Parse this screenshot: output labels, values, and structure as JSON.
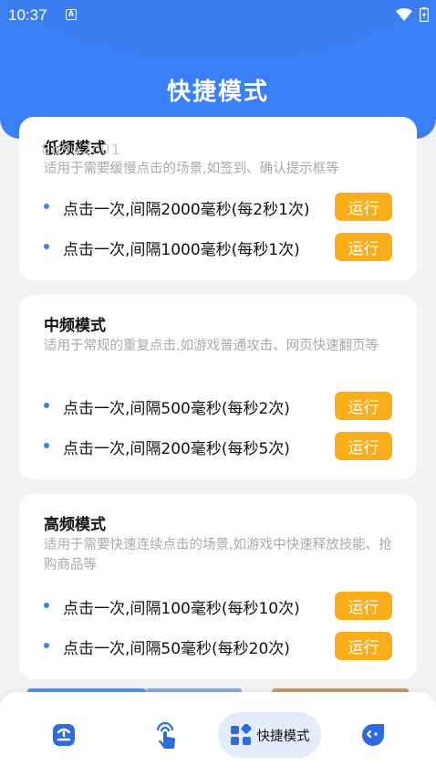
{
  "status_bar": {
    "time": "10:37",
    "badge": "A"
  },
  "header": {
    "title": "快捷模式"
  },
  "ghost_text": "8b9a2c01",
  "cards": [
    {
      "title": "低频模式",
      "desc": "适用于需要缓慢点击的场景,如签到、确认提示框等",
      "rows": [
        {
          "text": "点击一次,间隔2000毫秒(每2秒1次)",
          "button": "运行"
        },
        {
          "text": "点击一次,间隔1000毫秒(每秒1次)",
          "button": "运行"
        }
      ]
    },
    {
      "title": "中频模式",
      "desc": "适用于常规的重复点击,如游戏普通攻击、网页快速翻页等",
      "rows": [
        {
          "text": "点击一次,间隔500毫秒(每秒2次)",
          "button": "运行"
        },
        {
          "text": "点击一次,间隔200毫秒(每秒5次)",
          "button": "运行"
        }
      ]
    },
    {
      "title": "高频模式",
      "desc": "适用于需要快速连续点击的场景,如游戏中快速释放技能、抢购商品等",
      "rows": [
        {
          "text": "点击一次,间隔100毫秒(每秒10次)",
          "button": "运行"
        },
        {
          "text": "点击一次,间隔50毫秒(每秒20次)",
          "button": "运行"
        }
      ]
    }
  ],
  "nav": {
    "items": [
      {
        "icon": "home-icon"
      },
      {
        "icon": "tap-icon"
      },
      {
        "icon": "grid-icon",
        "label": "快捷模式",
        "active": true
      },
      {
        "icon": "chat-icon"
      }
    ]
  },
  "colors": {
    "primary": "#3a7ff4",
    "button": "#f9ad19",
    "background": "#f1f2f4"
  }
}
